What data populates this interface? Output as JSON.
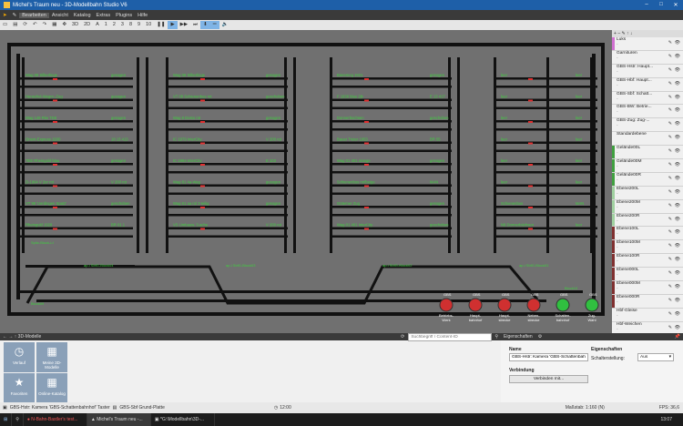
{
  "window": {
    "title": "Michel's Traum neu - 3D-Modellbahn Studio V6"
  },
  "menu": [
    "Bearbeiten",
    "Ansicht",
    "Katalog",
    "Extras",
    "Plugins",
    "Hilfe"
  ],
  "toolbar": {
    "b1": "1",
    "b2": "2",
    "b3": "3",
    "b4": "8",
    "b5": "9",
    "b6": "10",
    "m3d": "3D",
    "m2d": "2D",
    "a": "A"
  },
  "layers_panel": {
    "rows": [
      {
        "label": "Luks",
        "sub": "-",
        "color": "#d070d0"
      },
      {
        "label": "Garnituren",
        "sub": "-",
        "color": "#f0f0f0"
      },
      {
        "label": "GBS-Hstr: Haupt...",
        "sub": "-",
        "color": "#f0f0f0"
      },
      {
        "label": "GBS-Hbf: Haupt...",
        "sub": "-",
        "color": "#f0f0f0"
      },
      {
        "label": "GBS-Sbf: Schatt...",
        "sub": "-",
        "color": "#f0f0f0"
      },
      {
        "label": "GBS-BW: Betrie...",
        "sub": "-",
        "color": "#f0f0f0"
      },
      {
        "label": "GBS-Zug: Zug-...",
        "sub": "-",
        "color": "#f0f0f0"
      },
      {
        "label": "Standardebene",
        "sub": "",
        "color": "#f0f0f0"
      },
      {
        "label": "Gelände00L",
        "sub": "-",
        "color": "#40a040"
      },
      {
        "label": "Gelände00M",
        "sub": "-",
        "color": "#40a040"
      },
      {
        "label": "Gelände00R",
        "sub": "-",
        "color": "#40a040"
      },
      {
        "label": "Ebene200L",
        "sub": "-",
        "color": "#a0d0a0"
      },
      {
        "label": "Ebene200M",
        "sub": "-",
        "color": "#a0d0a0"
      },
      {
        "label": "Ebene200R",
        "sub": "-",
        "color": "#a0d0a0"
      },
      {
        "label": "Ebene100L",
        "sub": "-",
        "color": "#803030"
      },
      {
        "label": "Ebene100M",
        "sub": "-",
        "color": "#803030"
      },
      {
        "label": "Ebene100R",
        "sub": "-",
        "color": "#803030"
      },
      {
        "label": "Ebene000L",
        "sub": "-",
        "color": "#803030"
      },
      {
        "label": "Ebene000M",
        "sub": "-",
        "color": "#803030"
      },
      {
        "label": "Ebene000R",
        "sub": "-",
        "color": "#803030"
      },
      {
        "label": "Hbf-Gleise",
        "sub": "-",
        "color": "#f0f0f0"
      },
      {
        "label": "Hbf-Weichen",
        "sub": "-",
        "color": "#f0f0f0"
      }
    ]
  },
  "board_buttons": [
    {
      "code": "GBS",
      "label": "Betriebs-\nWerk",
      "state": "red"
    },
    {
      "code": "GBS",
      "label": "Haupt-\nbahnhof",
      "state": "red"
    },
    {
      "code": "GBS",
      "label": "Haupt-\nstrecke",
      "state": "red"
    },
    {
      "code": "GBS",
      "label": "Neben-\nstrecke",
      "state": "red"
    },
    {
      "code": "GBS",
      "label": "Schatten-\nbahnhof",
      "state": "green"
    },
    {
      "code": "GBS",
      "label": "Zug-\nWahl",
      "state": "green"
    }
  ],
  "track_labels": {
    "col1": [
      "Wag 08 Silberlinge",
      "Henschel-Wegm.-Zug",
      "Wag 148 Rke TEE",
      "Orient-Express 1930",
      "TEE Rheingold blau",
      "D-1964 V 2ur rot",
      "VT 98 'Uerdingen Spatz'",
      "Rheingold 1928"
    ],
    "col1_status": [
      "gesogen",
      "gesogen",
      "gesogen",
      "18 13 413",
      "gesogen",
      "V 200 rot",
      "geschoben",
      "BR 01.1"
    ],
    "col2": [
      "Wag 08 Silberlinge",
      "VT 08 Schienenbus rot",
      "Wag 8 Dosto rot",
      "IC 1979 InterCity",
      "IC 1994 InterCity",
      "Wag 81 4a-Wag",
      "Wag 61 aa rol 3-teilig",
      "VS Umbauw. 3-achs"
    ],
    "col2_status": [
      "gesogen",
      "geschoben",
      "gesogen",
      "V 200 rot",
      "E 103",
      "gesogen",
      "gesogen",
      "V 200 rot"
    ],
    "col3": [
      "Bieremeg 1921",
      "F 1936 blau 2jb",
      "Donnerbüchsen",
      "Bauer Truter 1953",
      "Wag 01 401 orange",
      "Schienenbus rot/beige",
      "Güterner Zug",
      "Wag 01 401 InterCity"
    ],
    "col3_status": [
      "gesogen",
      "E 13 417",
      "geschoben",
      "BR 55",
      "gesogen",
      "MAN",
      "gesogen",
      "geschoben"
    ],
    "col4": [
      "leer",
      "leer",
      "leer",
      "leer",
      "leer",
      "leer",
      "Schienenbus",
      "N8 Donnerbüchsen"
    ],
    "col4_status": [
      "leer",
      "leer",
      "leer",
      "leer",
      "leer",
      "leer",
      "MAN",
      "leer"
    ],
    "misc": [
      "Spitz-Block-Lt",
      "Block09",
      "ap-i SbfG-Block04",
      "ap-i SbfG-Block03",
      "ap-i SbfG-Block02",
      "ap-i SbfG-Block01",
      "Block10"
    ]
  },
  "bottom_left": {
    "header": "3D-Modelle",
    "search_placeholder": "Suchbegriff / Content-ID",
    "tiles": [
      {
        "icon": "clock",
        "label": "Verlauf"
      },
      {
        "icon": "grid",
        "label": "Meine 3D-Modelle"
      },
      {
        "icon": "star",
        "label": "Favoriten"
      },
      {
        "icon": "grid",
        "label": "Online-Katalog"
      }
    ]
  },
  "properties": {
    "header": "Eigenschaften",
    "name_label": "Name",
    "name_value": "GBS-Hstr: Kamera 'GBS-Schattenbahnhof'",
    "props_label": "Eigenschaften",
    "switch_label": "Schalterstellung:",
    "switch_value": "Aus",
    "connection_label": "Verbindung",
    "connect_button": "Verbinden mit..."
  },
  "status": {
    "left": "GBS-Hstr: Kamera 'GBS-Schattenbahnhof' Taster",
    "second": "GBS-Sbf Grund-Platte",
    "time": "12:00",
    "scale": "Maßstab: 1:160 (N)",
    "fps": "FPS: 36,6"
  },
  "taskbar": [
    {
      "label": "N-Bahn-Bastler's test..."
    },
    {
      "label": "Michel's Traum neu -..."
    },
    {
      "label": "*G:\\Modellbahn\\3D-..."
    }
  ],
  "clock": "13:07",
  "colors": {
    "accent": "#1e5fa8",
    "rail": "#707070",
    "track": "#111111",
    "label": "#3fcf3f",
    "signal_red": "#e03030"
  }
}
